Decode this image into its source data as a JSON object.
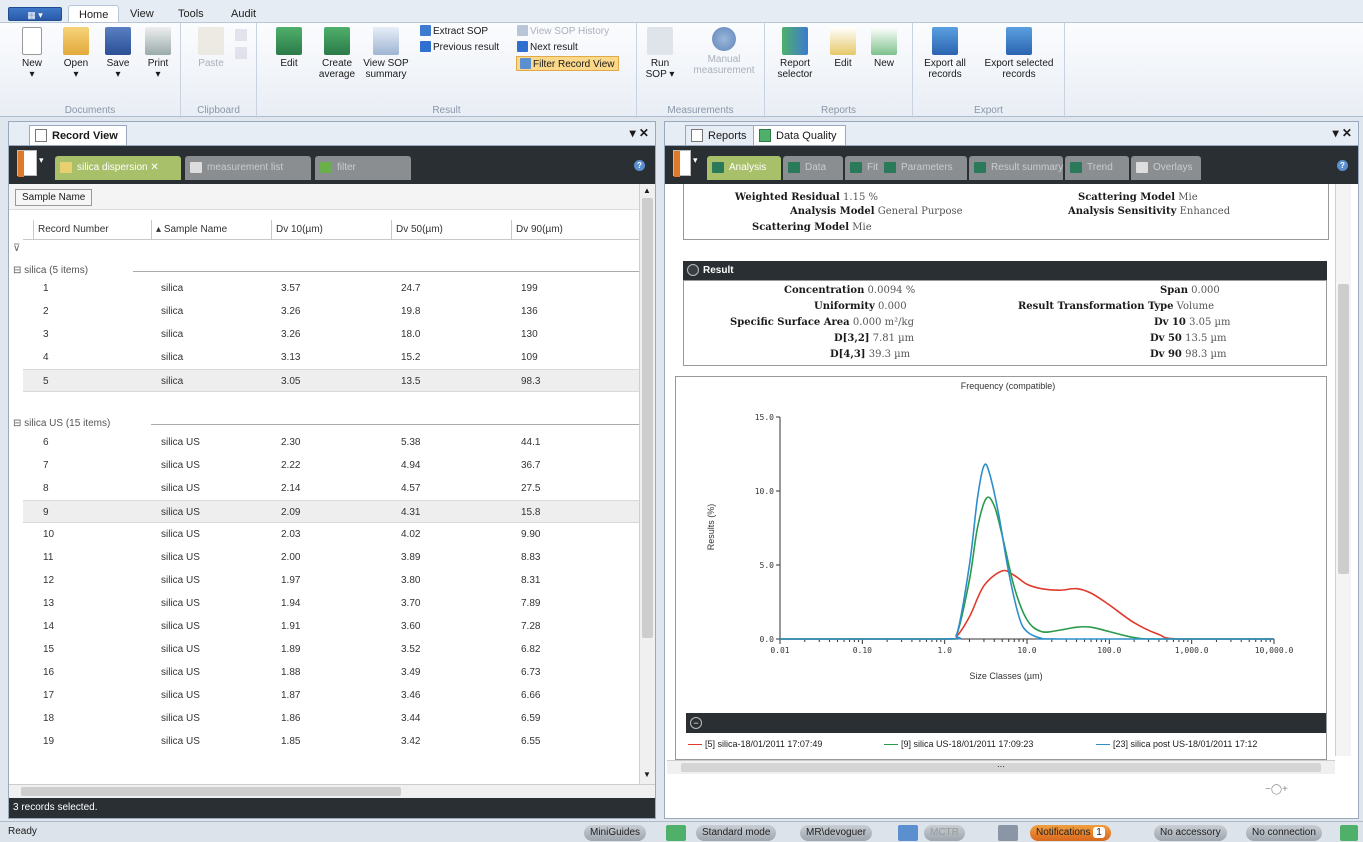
{
  "app": {
    "menu_button": "▦ ▾",
    "tabs": [
      "Home",
      "View",
      "Tools",
      "Audit"
    ]
  },
  "ribbon": {
    "documents": {
      "label": "Documents",
      "new": "New",
      "open": "Open",
      "save": "Save",
      "print": "Print"
    },
    "clipboard": {
      "label": "Clipboard",
      "paste": "Paste"
    },
    "result": {
      "label": "Result",
      "edit": "Edit",
      "create_average_1": "Create",
      "create_average_2": "average",
      "view_sop_1": "View SOP",
      "view_sop_2": "summary",
      "extract_sop": "Extract SOP",
      "previous_result": "Previous result",
      "view_sop_history": "View SOP History",
      "next_result": "Next result",
      "filter_record_view": "Filter Record View"
    },
    "measurements": {
      "label": "Measurements",
      "run_sop_1": "Run",
      "run_sop_2": "SOP ▾",
      "manual_1": "Manual",
      "manual_2": "measurement"
    },
    "reports": {
      "label": "Reports",
      "selector_1": "Report",
      "selector_2": "selector",
      "edit": "Edit",
      "new": "New"
    },
    "export": {
      "label": "Export",
      "all_1": "Export all",
      "all_2": "records",
      "sel_1": "Export selected",
      "sel_2": "records"
    }
  },
  "left": {
    "title": "Record View",
    "close": "▾ ✕",
    "tabs": [
      "silica dispersion",
      "measurement list",
      "filter"
    ],
    "group_button": "Sample Name",
    "columns": [
      "Record Number",
      "Sample Name",
      "Dv 10(µm)",
      "Dv 50(µm)",
      "Dv 90(µm)"
    ],
    "filter_glyph": "⊽",
    "group1": "silica (5 items)",
    "group2": "silica US (15 items)",
    "rows1": [
      {
        "n": "1",
        "s": "silica",
        "d10": "3.57",
        "d50": "24.7",
        "d90": "199"
      },
      {
        "n": "2",
        "s": "silica",
        "d10": "3.26",
        "d50": "19.8",
        "d90": "136"
      },
      {
        "n": "3",
        "s": "silica",
        "d10": "3.26",
        "d50": "18.0",
        "d90": "130"
      },
      {
        "n": "4",
        "s": "silica",
        "d10": "3.13",
        "d50": "15.2",
        "d90": "109"
      },
      {
        "n": "5",
        "s": "silica",
        "d10": "3.05",
        "d50": "13.5",
        "d90": "98.3"
      }
    ],
    "rows2": [
      {
        "n": "6",
        "s": "silica US",
        "d10": "2.30",
        "d50": "5.38",
        "d90": "44.1"
      },
      {
        "n": "7",
        "s": "silica US",
        "d10": "2.22",
        "d50": "4.94",
        "d90": "36.7"
      },
      {
        "n": "8",
        "s": "silica US",
        "d10": "2.14",
        "d50": "4.57",
        "d90": "27.5"
      },
      {
        "n": "9",
        "s": "silica US",
        "d10": "2.09",
        "d50": "4.31",
        "d90": "15.8"
      },
      {
        "n": "10",
        "s": "silica US",
        "d10": "2.03",
        "d50": "4.02",
        "d90": "9.90"
      },
      {
        "n": "11",
        "s": "silica US",
        "d10": "2.00",
        "d50": "3.89",
        "d90": "8.83"
      },
      {
        "n": "12",
        "s": "silica US",
        "d10": "1.97",
        "d50": "3.80",
        "d90": "8.31"
      },
      {
        "n": "13",
        "s": "silica US",
        "d10": "1.94",
        "d50": "3.70",
        "d90": "7.89"
      },
      {
        "n": "14",
        "s": "silica US",
        "d10": "1.91",
        "d50": "3.60",
        "d90": "7.28"
      },
      {
        "n": "15",
        "s": "silica US",
        "d10": "1.89",
        "d50": "3.52",
        "d90": "6.82"
      },
      {
        "n": "16",
        "s": "silica US",
        "d10": "1.88",
        "d50": "3.49",
        "d90": "6.73"
      },
      {
        "n": "17",
        "s": "silica US",
        "d10": "1.87",
        "d50": "3.46",
        "d90": "6.66"
      },
      {
        "n": "18",
        "s": "silica US",
        "d10": "1.86",
        "d50": "3.44",
        "d90": "6.59"
      },
      {
        "n": "19",
        "s": "silica US",
        "d10": "1.85",
        "d50": "3.42",
        "d90": "6.55"
      }
    ],
    "status": "3 records selected."
  },
  "right": {
    "tab_reports": "Reports",
    "tab_quality": "Data Quality",
    "close": "▾ ✕",
    "dark_tabs": [
      "Analysis",
      "Data",
      "Fit",
      "Parameters",
      "Result summary",
      "Trend",
      "Overlays"
    ],
    "analysis": {
      "weighted_residual_k": "Weighted Residual",
      "weighted_residual_v": "1.15 %",
      "analysis_model_k": "Analysis Model",
      "analysis_model_v": "General Purpose",
      "scattering_model_k": "Scattering Model",
      "scattering_model_v": "Mie",
      "scattering_model2_k": "Scattering Model",
      "scattering_model2_v": "Mie",
      "sensitivity_k": "Analysis Sensitivity",
      "sensitivity_v": "Enhanced"
    },
    "result": {
      "title": "Result",
      "concentration_k": "Concentration",
      "concentration_v": "0.0094 %",
      "uniformity_k": "Uniformity",
      "uniformity_v": "0.000",
      "ssa_k": "Specific Surface Area",
      "ssa_v": "0.000 m²/kg",
      "d32_k": "D[3,2]",
      "d32_v": "7.81 µm",
      "d43_k": "D[4,3]",
      "d43_v": "39.3 µm",
      "span_k": "Span",
      "span_v": "0.000",
      "rtt_k": "Result Transformation Type",
      "rtt_v": "Volume",
      "dv10_k": "Dv 10",
      "dv10_v": "3.05 µm",
      "dv50_k": "Dv 50",
      "dv50_v": "13.5 µm",
      "dv90_k": "Dv 90",
      "dv90_v": "98.3 µm"
    },
    "legend_bar": "",
    "legend_circle": "−",
    "hscroll_mid": "⋯",
    "zoom": "−◯+"
  },
  "chart_data": {
    "type": "line",
    "title": "Frequency (compatible)",
    "xlabel": "Size Classes (µm)",
    "ylabel": "Results (%)",
    "xscale": "log",
    "xlim": [
      0.01,
      10000
    ],
    "ylim": [
      0,
      15
    ],
    "xticks": [
      "0.01",
      "0.10",
      "1.0",
      "10.0",
      "100.0",
      "1,000.0",
      "10,000.0"
    ],
    "yticks": [
      "0.0",
      "5.0",
      "10.0",
      "15.0"
    ],
    "legend_position": "bottom",
    "series": [
      {
        "name": "[5] silica-18/01/2011 17:07:49",
        "color": "#e03a2e",
        "x": [
          0.01,
          1.0,
          1.4,
          2.0,
          3.0,
          5.0,
          7.0,
          10,
          15,
          25,
          40,
          60,
          100,
          200,
          400,
          700,
          10000
        ],
        "y": [
          0,
          0,
          0.2,
          1.5,
          3.6,
          4.6,
          4.3,
          3.7,
          3.4,
          3.3,
          3.4,
          3.1,
          2.3,
          1.1,
          0.3,
          0,
          0
        ]
      },
      {
        "name": "[9] silica US-18/01/2011 17:09:23",
        "color": "#2a9a4a",
        "x": [
          0.01,
          1.0,
          1.4,
          2.0,
          2.5,
          3.2,
          4.0,
          5.0,
          7.0,
          10,
          15,
          25,
          40,
          60,
          100,
          200,
          400,
          10000
        ],
        "y": [
          0,
          0,
          0.3,
          4.0,
          7.5,
          9.5,
          9.0,
          7.0,
          3.5,
          1.3,
          0.5,
          0.6,
          0.8,
          0.8,
          0.5,
          0.1,
          0,
          0
        ]
      },
      {
        "name": "[23] silica post US-18/01/2011 17:12",
        "color": "#2c8fc9",
        "x": [
          0.01,
          1.0,
          1.4,
          2.0,
          2.5,
          3.0,
          3.5,
          4.5,
          6.0,
          8.0,
          10,
          15,
          25,
          10000
        ],
        "y": [
          0,
          0,
          0.3,
          5.0,
          9.5,
          11.7,
          11.2,
          8.5,
          4.5,
          1.5,
          0.5,
          0.05,
          0,
          0
        ]
      }
    ]
  },
  "statusbar": {
    "ready": "Ready",
    "miniguides": "MiniGuides",
    "mode": "Standard mode",
    "user": "MR\\devoguer",
    "mctr": "MCTR",
    "notifications": "Notifications",
    "notif_count": "1",
    "accessory": "No accessory",
    "connection": "No connection"
  },
  "colors": {
    "accent": "#2a5aa8",
    "dark_bar": "#2a2f33",
    "active_tab": "#a8c06a",
    "notification": "#e07a2a"
  }
}
